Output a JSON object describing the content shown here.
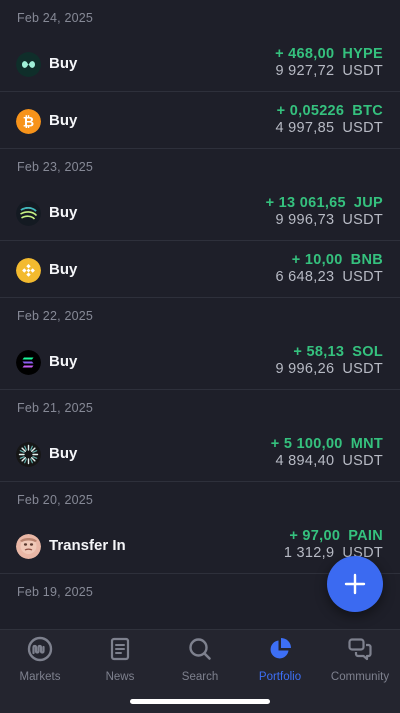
{
  "groups": [
    {
      "date": "Feb 24, 2025",
      "rows": [
        {
          "type": "Buy",
          "coin_icon": "hype-icon",
          "qty": "+ 468,00",
          "qty_symbol": "HYPE",
          "cost": "9 927,72",
          "cost_symbol": "USDT"
        },
        {
          "type": "Buy",
          "coin_icon": "bitcoin-icon",
          "qty": "+ 0,05226",
          "qty_symbol": "BTC",
          "cost": "4 997,85",
          "cost_symbol": "USDT"
        }
      ]
    },
    {
      "date": "Feb 23, 2025",
      "rows": [
        {
          "type": "Buy",
          "coin_icon": "jupiter-icon",
          "qty": "+ 13 061,65",
          "qty_symbol": "JUP",
          "cost": "9 996,73",
          "cost_symbol": "USDT"
        },
        {
          "type": "Buy",
          "coin_icon": "bnb-icon",
          "qty": "+ 10,00",
          "qty_symbol": "BNB",
          "cost": "6 648,23",
          "cost_symbol": "USDT"
        }
      ]
    },
    {
      "date": "Feb 22, 2025",
      "rows": [
        {
          "type": "Buy",
          "coin_icon": "solana-icon",
          "qty": "+ 58,13",
          "qty_symbol": "SOL",
          "cost": "9 996,26",
          "cost_symbol": "USDT"
        }
      ]
    },
    {
      "date": "Feb 21, 2025",
      "rows": [
        {
          "type": "Buy",
          "coin_icon": "mantle-icon",
          "qty": "+ 5 100,00",
          "qty_symbol": "MNT",
          "cost": "4 894,40",
          "cost_symbol": "USDT"
        }
      ]
    },
    {
      "date": "Feb 20, 2025",
      "rows": [
        {
          "type": "Transfer In",
          "coin_icon": "pain-token-icon",
          "qty": "+ 97,00",
          "qty_symbol": "PAIN",
          "cost": "1 312,9",
          "cost_symbol": "USDT"
        }
      ]
    },
    {
      "date": "Feb 19, 2025",
      "rows": []
    }
  ],
  "fab": {
    "icon": "plus-icon"
  },
  "tabbar": {
    "tabs": [
      {
        "label": "Markets",
        "icon": "markets-icon",
        "active": false
      },
      {
        "label": "News",
        "icon": "news-icon",
        "active": false
      },
      {
        "label": "Search",
        "icon": "search-icon",
        "active": false
      },
      {
        "label": "Portfolio",
        "icon": "portfolio-pie-icon",
        "active": true
      },
      {
        "label": "Community",
        "icon": "community-chat-icon",
        "active": false
      }
    ]
  },
  "colors": {
    "background": "#1e1f29",
    "positive": "#35c17e",
    "accent": "#3b6af1",
    "muted_text": "#868996"
  }
}
